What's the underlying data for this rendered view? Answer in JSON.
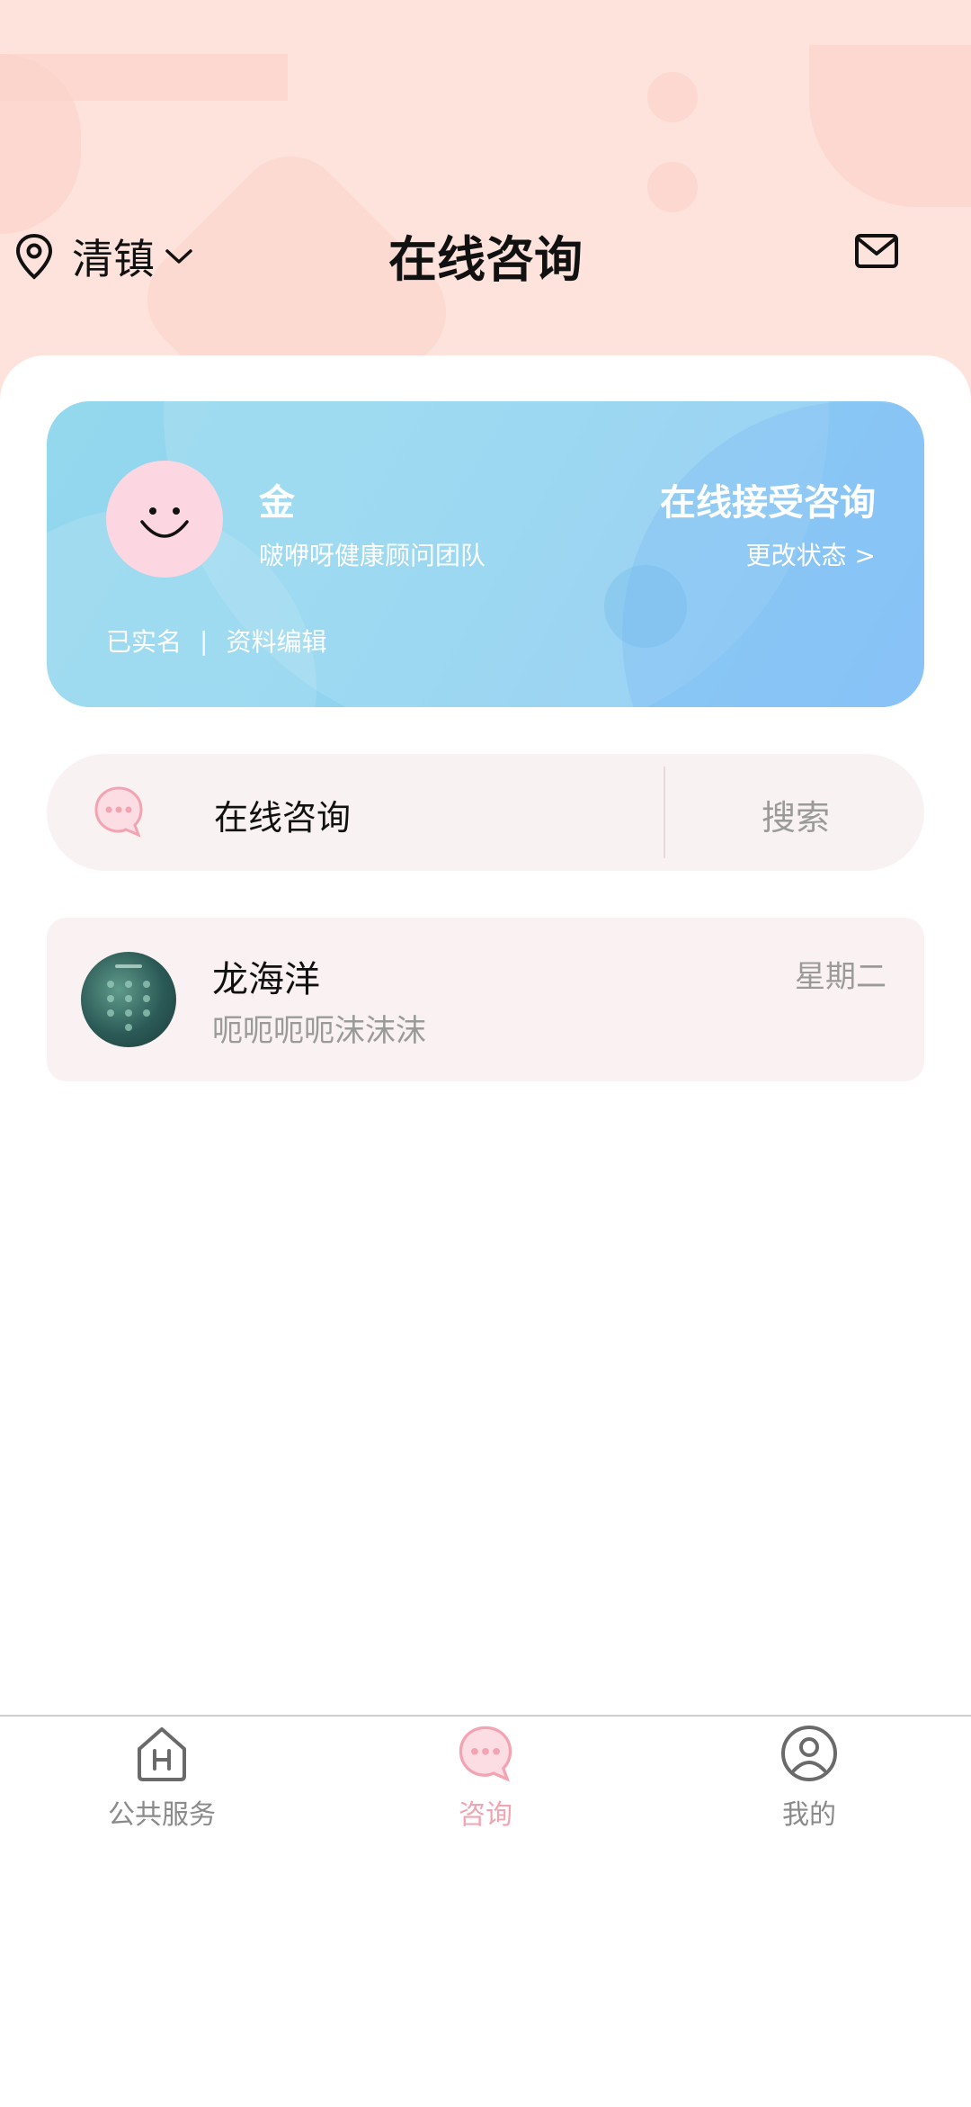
{
  "header": {
    "location": "清镇",
    "title": "在线咨询"
  },
  "profile_card": {
    "name": "金",
    "team": "啵咿呀健康顾问团队",
    "status": "在线接受咨询",
    "change_status": "更改状态 >",
    "verified": "已实名",
    "separator": "|",
    "edit_profile": "资料编辑"
  },
  "search_bar": {
    "label": "在线咨询",
    "search": "搜索"
  },
  "conversations": [
    {
      "name": "龙海洋",
      "message": "呃呃呃呃沫沫沫",
      "day": "星期二"
    }
  ],
  "bottom_nav": {
    "items": [
      {
        "label": "公共服务",
        "icon": "home-icon",
        "active": false
      },
      {
        "label": "咨询",
        "icon": "chat-icon",
        "active": true
      },
      {
        "label": "我的",
        "icon": "user-icon",
        "active": false
      }
    ]
  },
  "colors": {
    "header_bg": "#fde3dc",
    "active_pink": "#f3a3b1",
    "inactive_gray": "#8a8a8a"
  }
}
